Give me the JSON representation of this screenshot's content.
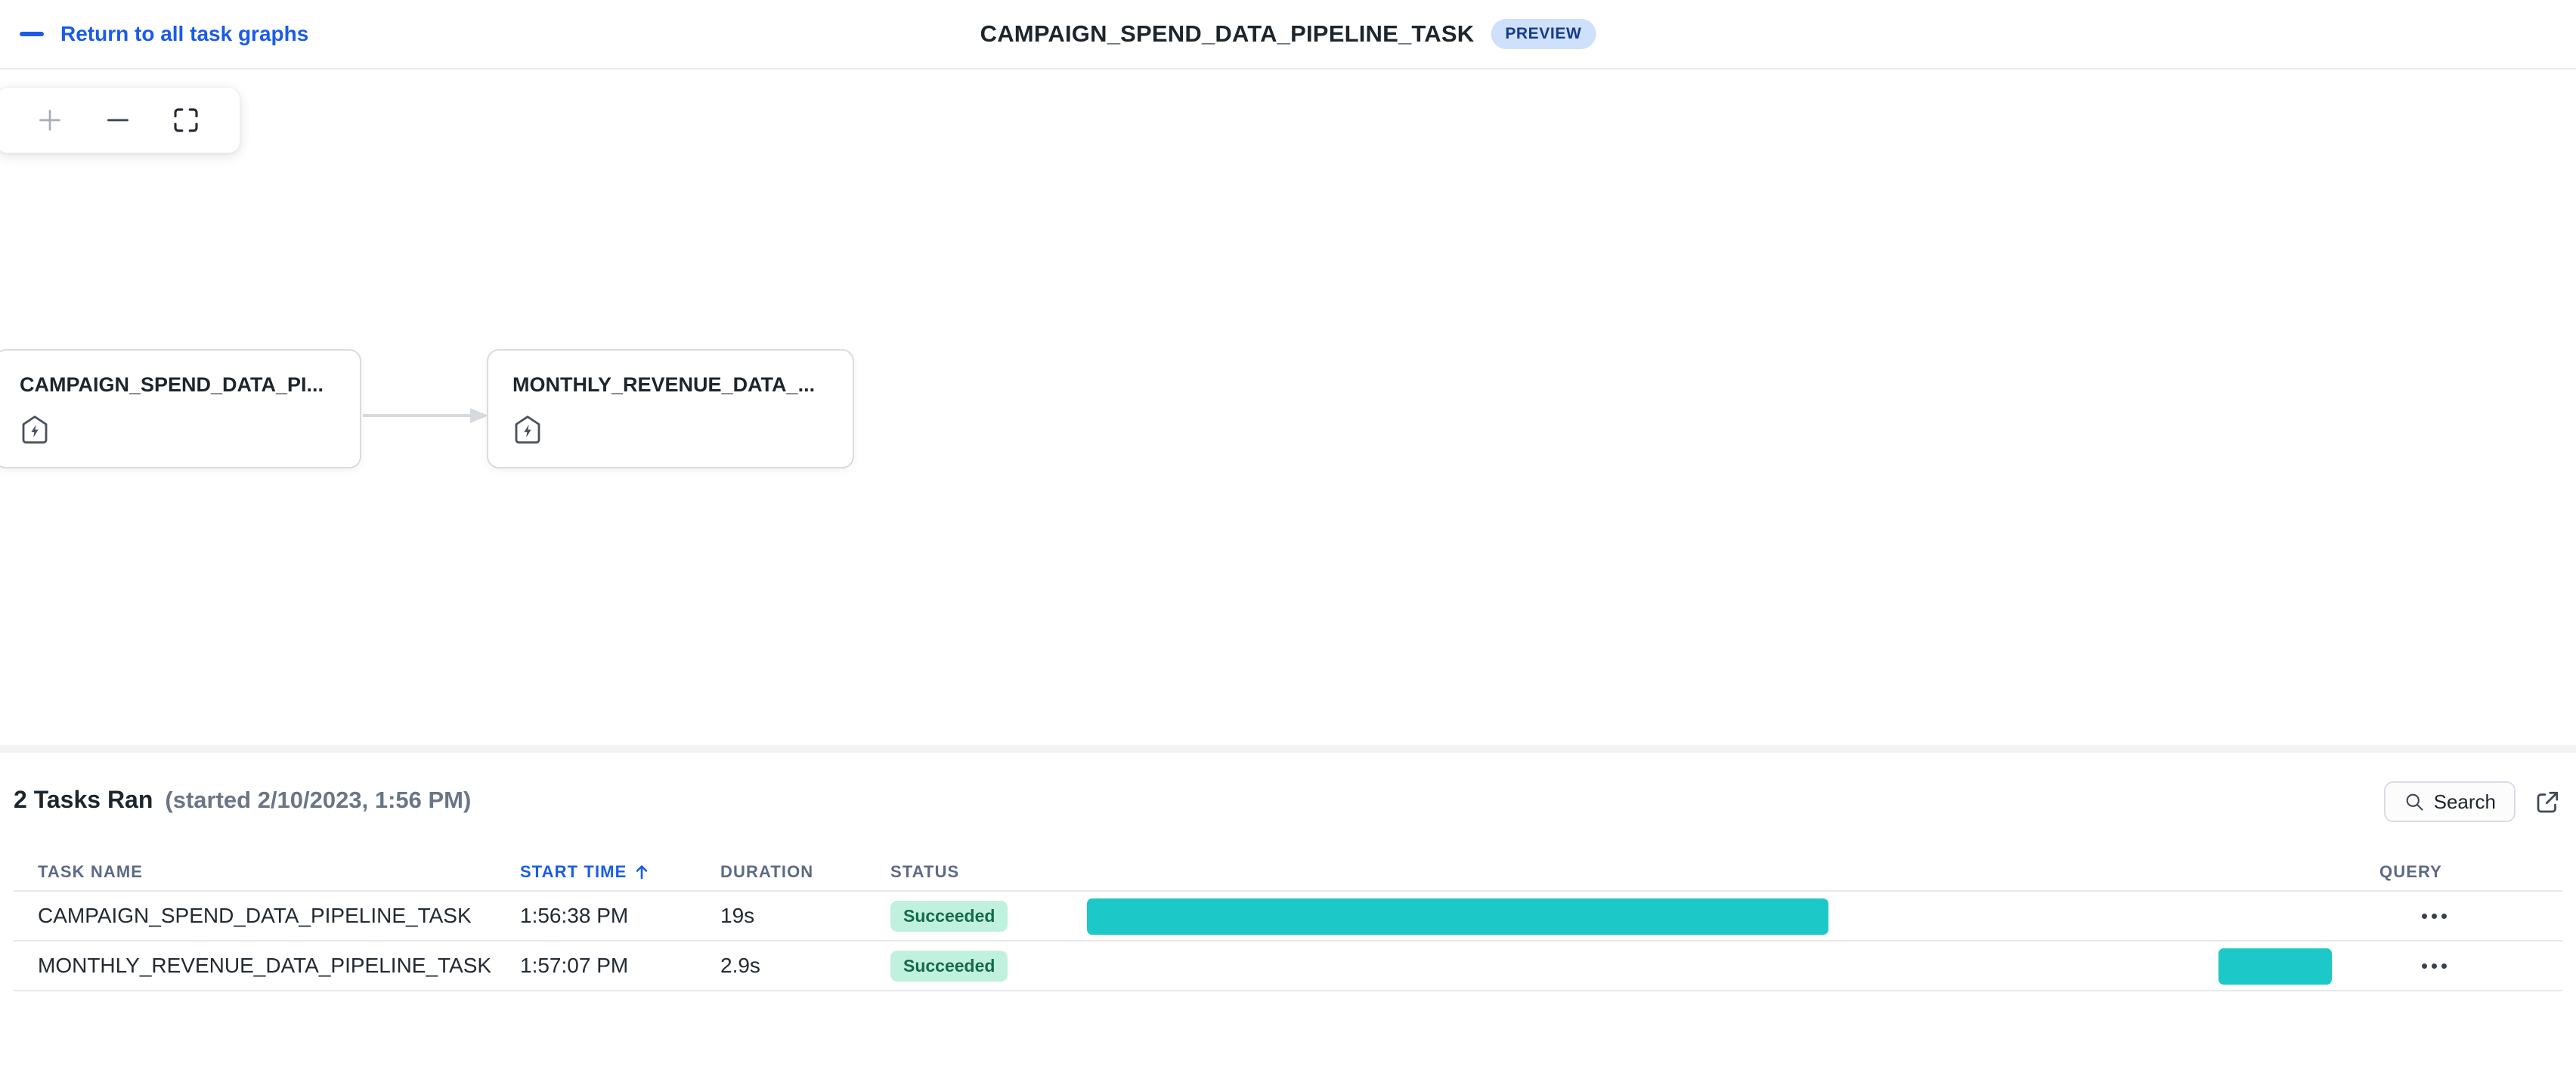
{
  "header": {
    "back_label": "Return to all task graphs",
    "title": "CAMPAIGN_SPEND_DATA_PIPELINE_TASK",
    "badge": "PREVIEW"
  },
  "canvas": {
    "nodes": [
      {
        "label": "CAMPAIGN_SPEND_DATA_PI...",
        "icon": "task-bolt-tag"
      },
      {
        "label": "MONTHLY_REVENUE_DATA_...",
        "icon": "task-bolt-tag"
      }
    ],
    "edges": [
      {
        "from": 0,
        "to": 1
      }
    ]
  },
  "runs": {
    "title": "2 Tasks Ran",
    "subtitle": "(started 2/10/2023, 1:56 PM)",
    "search_label": "Search",
    "columns": {
      "name": "TASK NAME",
      "start": "START TIME",
      "duration": "DURATION",
      "status": "STATUS",
      "query": "QUERY"
    },
    "sort": {
      "column": "START TIME",
      "direction": "ascending"
    },
    "gantt_window_s": 32,
    "rows": [
      {
        "name": "CAMPAIGN_SPEND_DATA_PIPELINE_TASK",
        "start_time": "1:56:38 PM",
        "duration": "19s",
        "status": "Succeeded",
        "gantt_offset_s": 0,
        "gantt_duration_s": 19
      },
      {
        "name": "MONTHLY_REVENUE_DATA_PIPELINE_TASK",
        "start_time": "1:57:07 PM",
        "duration": "2.9s",
        "status": "Succeeded",
        "gantt_offset_s": 29,
        "gantt_duration_s": 2.9
      }
    ]
  },
  "icons": {
    "back_dash": "—",
    "zoom_in": "+",
    "zoom_out": "−",
    "fit_view": "corner-brackets",
    "task_node": "tag-with-lightning-bolt",
    "search": "magnifier",
    "open_in_new": "external-link-arrow",
    "sort_ascending": "↑",
    "row_actions": "•••"
  },
  "colors": {
    "accent_blue": "#1a5ce8",
    "gantt_bar": "#1cc8c8",
    "succeeded_badge_bg": "#c0f1de",
    "succeeded_badge_text": "#15694c",
    "preview_badge_bg": "#cfe0fb",
    "preview_badge_text": "#143a8c"
  }
}
